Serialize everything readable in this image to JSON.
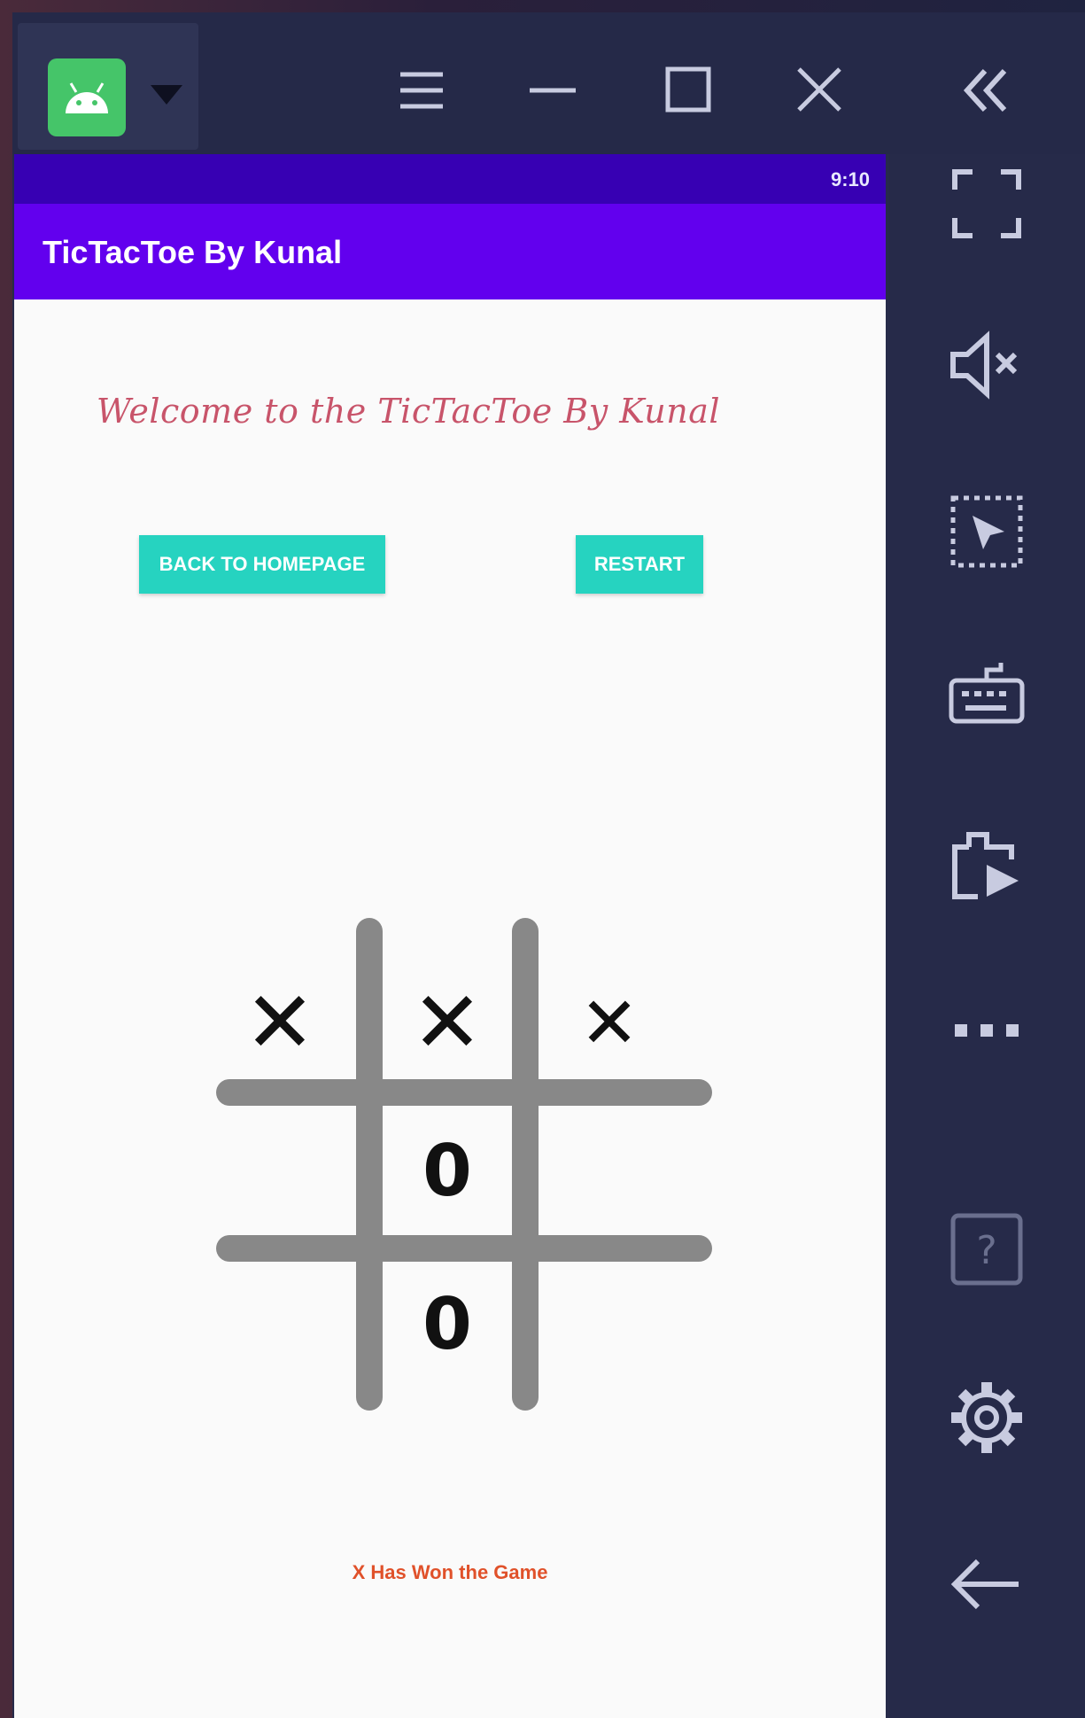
{
  "status": {
    "time": "9:10"
  },
  "app": {
    "title": "TicTacToe By Kunal"
  },
  "welcome": "Welcome to the TicTacToe By Kunal",
  "buttons": {
    "home": "BACK TO HOMEPAGE",
    "restart": "RESTART"
  },
  "board": {
    "cells": [
      "✕",
      "✕",
      "✕",
      "",
      "0",
      "",
      "",
      "0",
      ""
    ]
  },
  "result": "X Has Won the Game",
  "colors": {
    "status_bar": "#3700b3",
    "app_bar": "#6200ee",
    "button": "#26d3c0",
    "welcome_text": "#c8546a",
    "result_text": "#e0512a",
    "grid": "#888888"
  },
  "toolbar_icons": [
    "android-icon",
    "dropdown-icon",
    "menu-icon",
    "minimize-icon",
    "maximize-icon",
    "close-icon",
    "collapse-sidebar-icon"
  ],
  "sidebar_icons": [
    "fullscreen-icon",
    "volume-mute-icon",
    "cursor-select-icon",
    "keyboard-icon",
    "install-apk-icon",
    "more-icon",
    "help-icon",
    "settings-icon",
    "back-icon"
  ]
}
